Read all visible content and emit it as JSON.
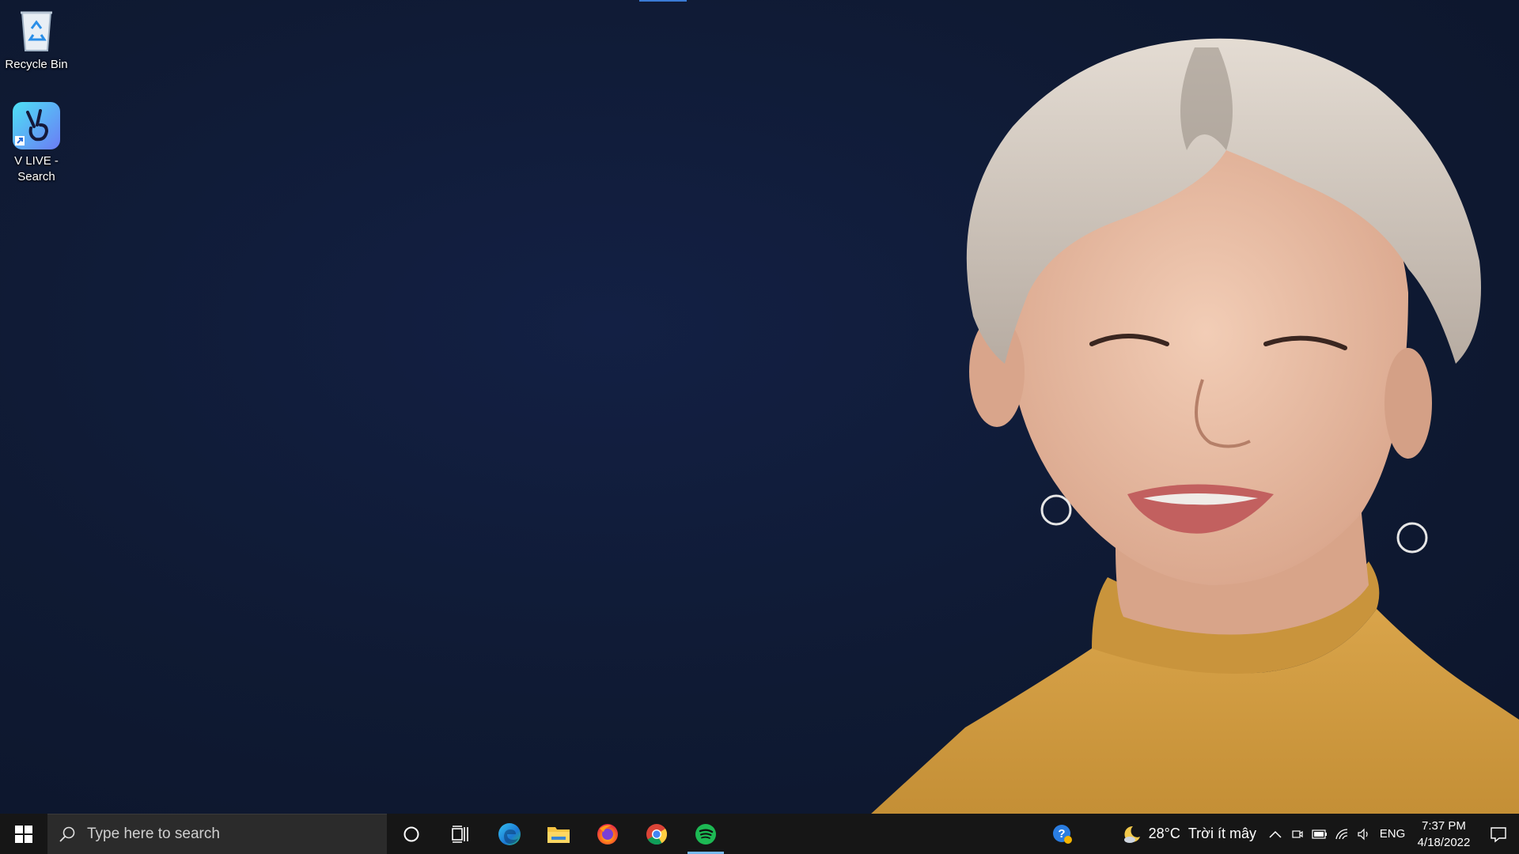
{
  "desktop": {
    "icons": [
      {
        "label": "Recycle Bin",
        "icon": "recycle-bin-icon"
      },
      {
        "label": "V LIVE - Search",
        "label_line1": "V LIVE -",
        "label_line2": "Search",
        "icon": "vlive-icon"
      }
    ],
    "wallpaper": {
      "subject": "portrait-photo",
      "background_color": "#101a33"
    }
  },
  "taskbar": {
    "search_placeholder": "Type here to search",
    "pinned": [
      {
        "name": "cortana",
        "icon": "cortana-icon"
      },
      {
        "name": "task-view",
        "icon": "task-view-icon"
      },
      {
        "name": "edge",
        "icon": "edge-icon"
      },
      {
        "name": "file-explorer",
        "icon": "folder-icon"
      },
      {
        "name": "firefox",
        "icon": "firefox-icon"
      },
      {
        "name": "chrome",
        "icon": "chrome-icon"
      },
      {
        "name": "spotify",
        "icon": "spotify-icon",
        "active": true
      }
    ],
    "tray": {
      "weather_temp": "28°C",
      "weather_desc": "Trời ít mây",
      "language": "ENG",
      "time": "7:37 PM",
      "date": "4/18/2022"
    }
  },
  "colors": {
    "taskbar": "#161616",
    "search_box": "#2b2b2b",
    "active_indicator": "#76b9ed",
    "spotify": "#1db954"
  }
}
